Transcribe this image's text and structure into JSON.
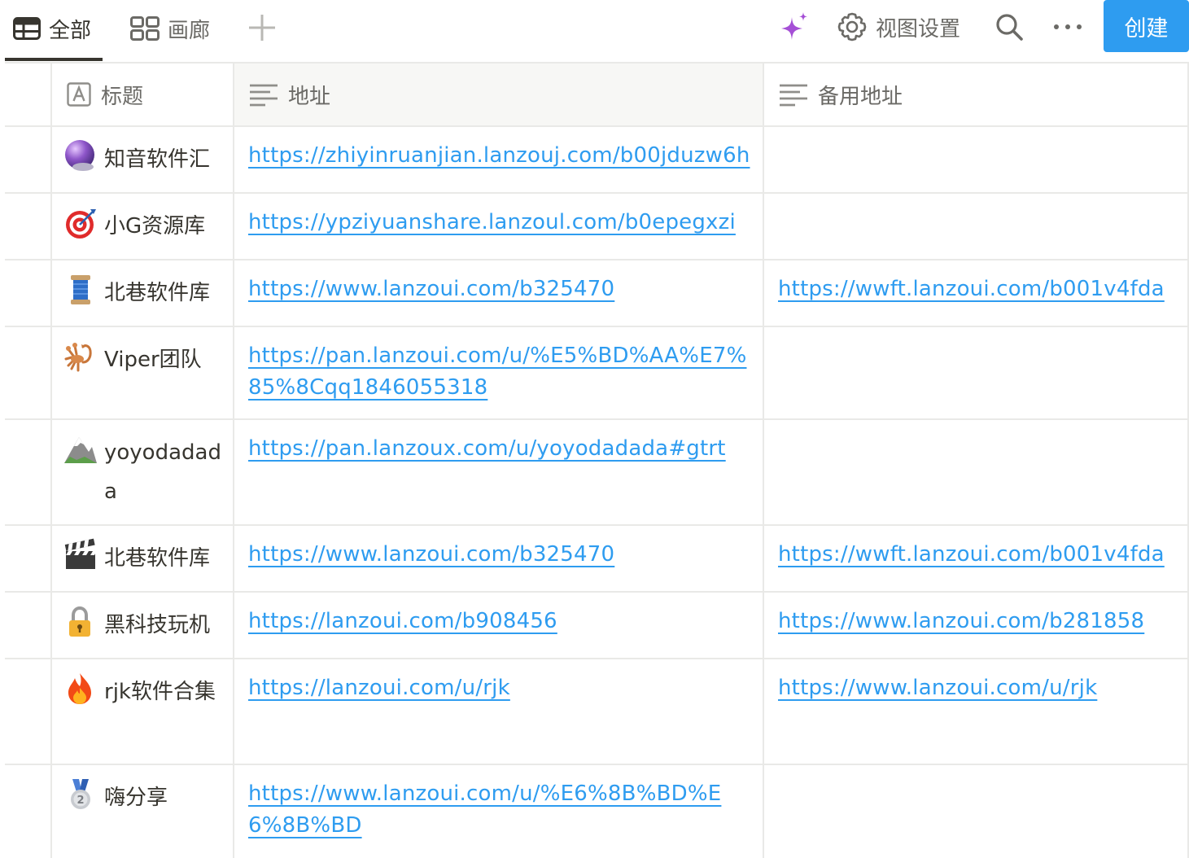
{
  "toolbar": {
    "tabs": [
      {
        "label": "全部",
        "icon": "table-icon",
        "active": true
      },
      {
        "label": "画廊",
        "icon": "gallery-icon",
        "active": false
      }
    ],
    "settings_label": "视图设置",
    "create_label": "创建",
    "accent_color": "#2e9cf0"
  },
  "table": {
    "columns": [
      {
        "label": "标题",
        "icon": "text-type-icon"
      },
      {
        "label": "地址",
        "icon": "lines-icon"
      },
      {
        "label": "备用地址",
        "icon": "lines-icon"
      }
    ],
    "rows": [
      {
        "icon": "crystal-ball-icon",
        "title": "知音软件汇",
        "url": "https://zhiyinruanjian.lanzouj.com/b00jduzw6h",
        "alt_url": ""
      },
      {
        "icon": "target-icon",
        "title": "小G资源库",
        "url": "https://ypziyuanshare.lanzoul.com/b0epegxzi",
        "alt_url": ""
      },
      {
        "icon": "thread-spool-icon",
        "title": "北巷软件库",
        "url": "https://www.lanzoui.com/b325470",
        "alt_url": "https://wwft.lanzoui.com/b001v4fda"
      },
      {
        "icon": "scorpion-icon",
        "title": "Viper团队",
        "url": "https://pan.lanzoui.com/u/%E5%BD%AA%E7%85%8Cqq1846055318",
        "alt_url": ""
      },
      {
        "icon": "mountain-icon",
        "title": "yoyodadada",
        "url": "https://pan.lanzoux.com/u/yoyodadada#gtrt",
        "alt_url": ""
      },
      {
        "icon": "clapper-board-icon",
        "title": "北巷软件库",
        "url": "https://www.lanzoui.com/b325470",
        "alt_url": "https://wwft.lanzoui.com/b001v4fda"
      },
      {
        "icon": "lock-icon",
        "title": "黑科技玩机",
        "url": "https://lanzoui.com/b908456",
        "alt_url": "https://www.lanzoui.com/b281858"
      },
      {
        "icon": "fire-icon",
        "title": "rjk软件合集",
        "url": "https://lanzoui.com/u/rjk",
        "alt_url": "https://www.lanzoui.com/u/rjk"
      },
      {
        "icon": "silver-medal-icon",
        "title": "嗨分享",
        "url": "https://www.lanzoui.com/u/%E6%8B%BD%E6%8B%BD",
        "alt_url": ""
      }
    ]
  }
}
